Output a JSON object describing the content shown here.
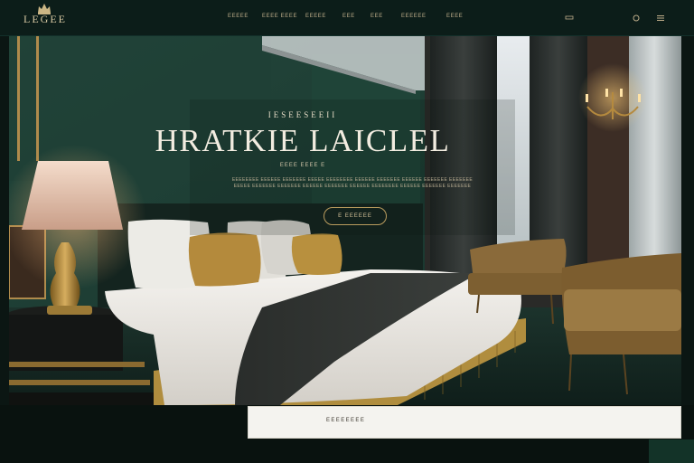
{
  "nav": {
    "logo": "LEGEE",
    "links": [
      "EEEEE",
      "EEEE EEEE",
      "EEEEE",
      "EEE",
      "EEE",
      "EEEEEE",
      "EEEE"
    ],
    "icons": [
      "account-icon",
      "search-icon",
      "menu-icon"
    ]
  },
  "hero": {
    "eyebrow": "IESEESEEII",
    "title": "HRATKIE LAICLEL",
    "subtitle": "EEEE EEEE E",
    "description": "EEEEEEEE EEEEEE EEEEEEE EEEEE EEEEEEEE EEEEEE EEEEEEE EEEEEE EEEEEEE EEEEEEE EEEEE EEEEEEE EEEEEEE EEEEEE EEEEEEE EEEEEE EEEEEEEE EEEEEE EEEEEEE EEEEEEE",
    "cta_label": "E EEEEEE"
  },
  "booking": {
    "label": "EEEEEEEE"
  },
  "colors": {
    "nav_bg": "#0c1d19",
    "wall_green": "#1d3b32",
    "gold_accent": "#b99c5e",
    "panel_bg": "#f4f3ef"
  }
}
